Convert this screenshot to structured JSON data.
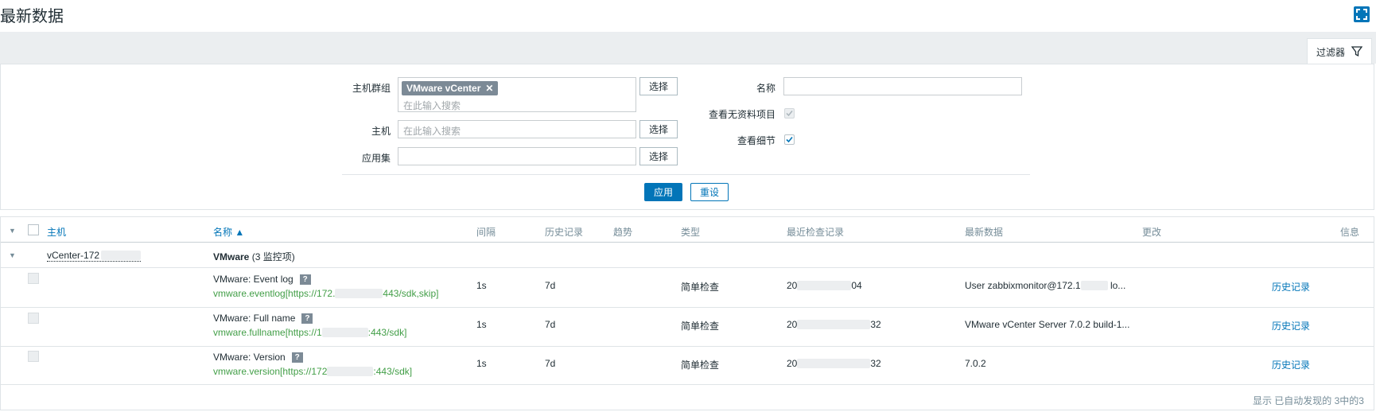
{
  "page": {
    "title": "最新数据"
  },
  "filter": {
    "tab_label": "过滤器",
    "host_groups": {
      "label": "主机群组",
      "tag": "VMware vCenter",
      "placeholder": "在此输入搜索",
      "select_label": "选择"
    },
    "hosts": {
      "label": "主机",
      "placeholder": "在此输入搜索",
      "select_label": "选择"
    },
    "application": {
      "label": "应用集",
      "value": "",
      "select_label": "选择"
    },
    "name": {
      "label": "名称",
      "value": ""
    },
    "show_without_data": {
      "label": "查看无资料项目",
      "checked": true,
      "disabled": true
    },
    "show_details": {
      "label": "查看细节",
      "checked": true
    },
    "apply_label": "应用",
    "reset_label": "重设"
  },
  "table": {
    "headers": {
      "host": "主机",
      "name": "名称 ▲",
      "interval": "间隔",
      "history": "历史记录",
      "trends": "趋势",
      "type": "类型",
      "last_check": "最近检查记录",
      "last_value": "最新数据",
      "change": "更改",
      "info": "信息"
    },
    "host_row": {
      "host": "vCenter-172",
      "app": "VMware",
      "app_count": "(3 监控项)"
    },
    "rows": [
      {
        "name": "VMware: Event log",
        "key_a": "vmware.eventlog[https://172.",
        "key_b": "443/sdk,skip]",
        "interval": "1s",
        "history": "7d",
        "type": "简单检查",
        "check_a": "20",
        "check_b": "04",
        "value_a": "User zabbixmonitor@172.1",
        "value_b": "lo...",
        "action": "历史记录"
      },
      {
        "name": "VMware: Full name",
        "key_a": "vmware.fullname[https://1",
        "key_b": ":443/sdk]",
        "interval": "1s",
        "history": "7d",
        "type": "简单检查",
        "check_a": "20",
        "check_b": "32",
        "value_a": "VMware vCenter Server 7.0.2 build-1...",
        "value_b": "",
        "action": "历史记录"
      },
      {
        "name": "VMware: Version",
        "key_a": "vmware.version[https://172",
        "key_b": ":443/sdk]",
        "interval": "1s",
        "history": "7d",
        "type": "简单检查",
        "check_a": "20",
        "check_b": "32",
        "value_a": "7.0.2",
        "value_b": "",
        "action": "历史记录"
      }
    ],
    "footer": "显示 已自动发现的 3中的3"
  }
}
